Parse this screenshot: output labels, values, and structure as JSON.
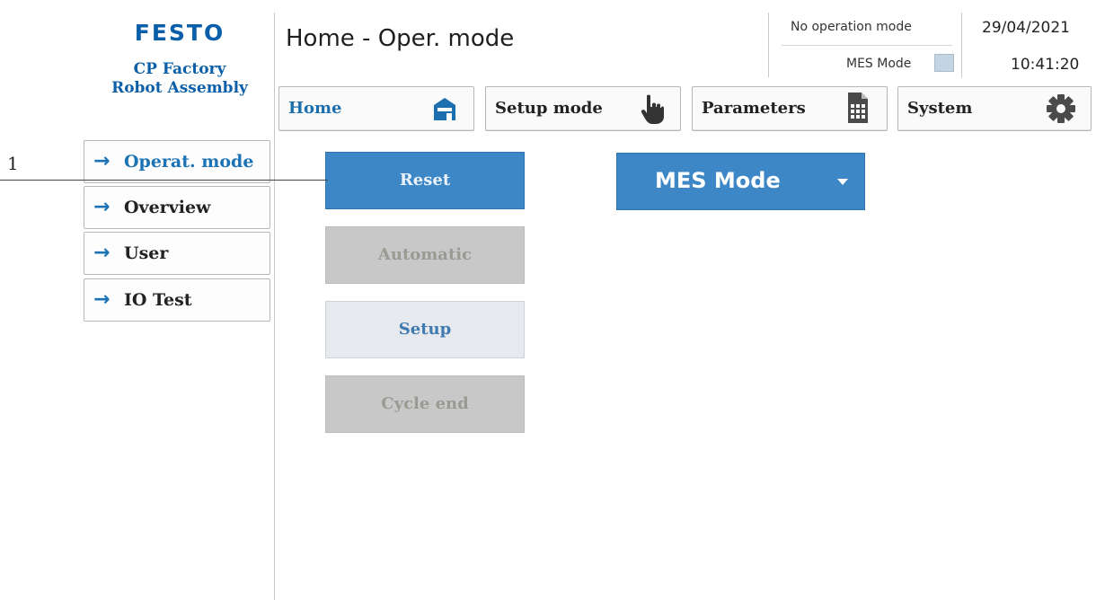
{
  "logo": {
    "brand": "FESTO",
    "line1": "CP Factory",
    "line2": "Robot Assembly"
  },
  "header": {
    "title": "Home - Oper. mode",
    "operation_mode": "No operation mode",
    "mes_mode_label": "MES Mode",
    "date": "29/04/2021",
    "time": "10:41:20"
  },
  "nav": {
    "home": "Home",
    "setup_mode": "Setup mode",
    "parameters": "Parameters",
    "system": "System"
  },
  "side_menu": {
    "items": [
      {
        "label": "Operat. mode",
        "arrow": "→"
      },
      {
        "label": "Overview",
        "arrow": "→"
      },
      {
        "label": "User",
        "arrow": "→"
      },
      {
        "label": "IO Test",
        "arrow": "→"
      }
    ]
  },
  "modes": {
    "reset": "Reset",
    "automatic": "Automatic",
    "setup": "Setup",
    "cycle_end": "Cycle end"
  },
  "mes_select": {
    "value": "MES Mode"
  },
  "annotation": {
    "number": "1"
  },
  "colors": {
    "accent": "#3d87c6",
    "brand": "#0a5fa8",
    "disabled": "#c8c8c8"
  },
  "icons": {
    "home": "building-icon",
    "setup_mode": "hand-pointer-icon",
    "parameters": "document-grid-icon",
    "system": "gear-icon",
    "menu_arrow": "arrow-right-icon",
    "dropdown": "caret-down-icon"
  }
}
